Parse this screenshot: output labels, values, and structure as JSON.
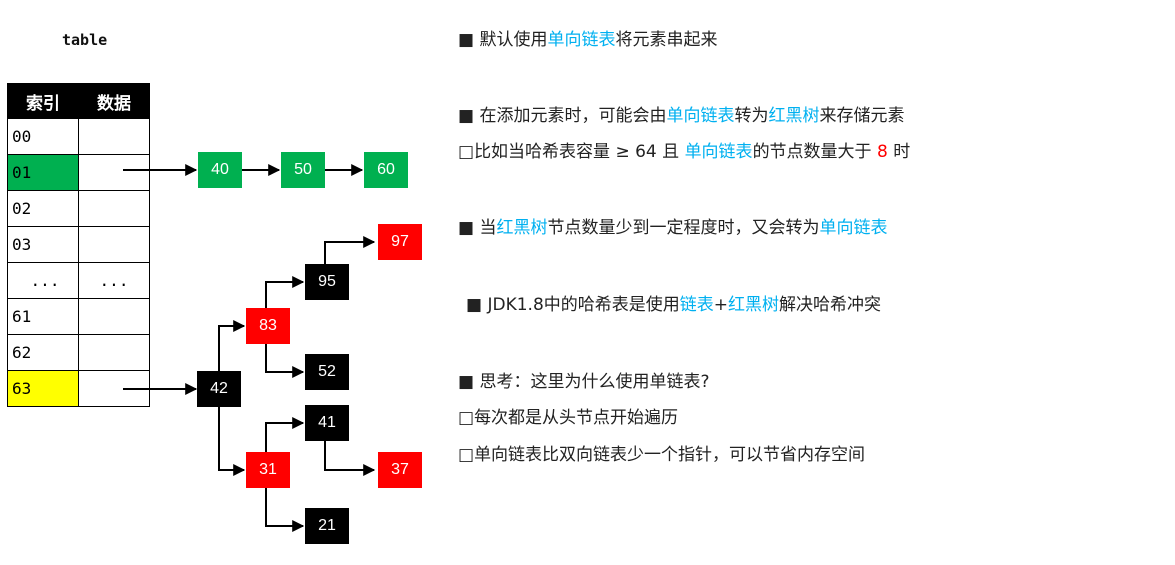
{
  "table": {
    "title": "table",
    "header": [
      "索引",
      "数据"
    ],
    "rows": [
      {
        "index": "00",
        "data": "",
        "color": ""
      },
      {
        "index": "01",
        "data": "",
        "color": "#00b050"
      },
      {
        "index": "02",
        "data": "",
        "color": ""
      },
      {
        "index": "03",
        "data": "",
        "color": ""
      },
      {
        "index": "...",
        "data": "...",
        "color": ""
      },
      {
        "index": "61",
        "data": "",
        "color": ""
      },
      {
        "index": "62",
        "data": "",
        "color": ""
      },
      {
        "index": "63",
        "data": "",
        "color": "#ffff00"
      }
    ]
  },
  "nodes": {
    "n40": "40",
    "n50": "50",
    "n60": "60",
    "n42": "42",
    "n83": "83",
    "n95": "95",
    "n97": "97",
    "n52": "52",
    "n31": "31",
    "n41": "41",
    "n37": "37",
    "n21": "21"
  },
  "colors": {
    "green": "#00b050",
    "red": "#ff0000",
    "black": "#000000",
    "highlight": "#00b0f0"
  },
  "notes": {
    "l1": {
      "bullet": "■",
      "a": "默认使用",
      "b": "单向链表",
      "c": "将元素串起来"
    },
    "l2": {
      "bullet": "■",
      "a": "在添加元素时，可能会由",
      "b": "单向链表",
      "c": "转为",
      "d": "红黑树",
      "e": "来存储元素"
    },
    "l3": {
      "bullet": "□",
      "a": "比如当哈希表容量 ≥ 64 且 ",
      "b": "单向链表",
      "c": "的节点数量大于 ",
      "d": "8",
      "e": " 时"
    },
    "l4": {
      "bullet": "■",
      "a": "当",
      "b": "红黑树",
      "c": "节点数量少到一定程度时，又会转为",
      "d": "单向链表"
    },
    "l5": {
      "bullet": "■",
      "a": "JDK1.8中的哈希表是使用",
      "b": "链表",
      "c": "+",
      "d": "红黑树",
      "e": "解决哈希冲突"
    },
    "l6": {
      "bullet": "■",
      "a": "思考：这里为什么使用单链表?"
    },
    "l7": {
      "bullet": "□",
      "a": "每次都是从头节点开始遍历"
    },
    "l8": {
      "bullet": "□",
      "a": "单向链表比双向链表少一个指针，可以节省内存空间"
    }
  }
}
